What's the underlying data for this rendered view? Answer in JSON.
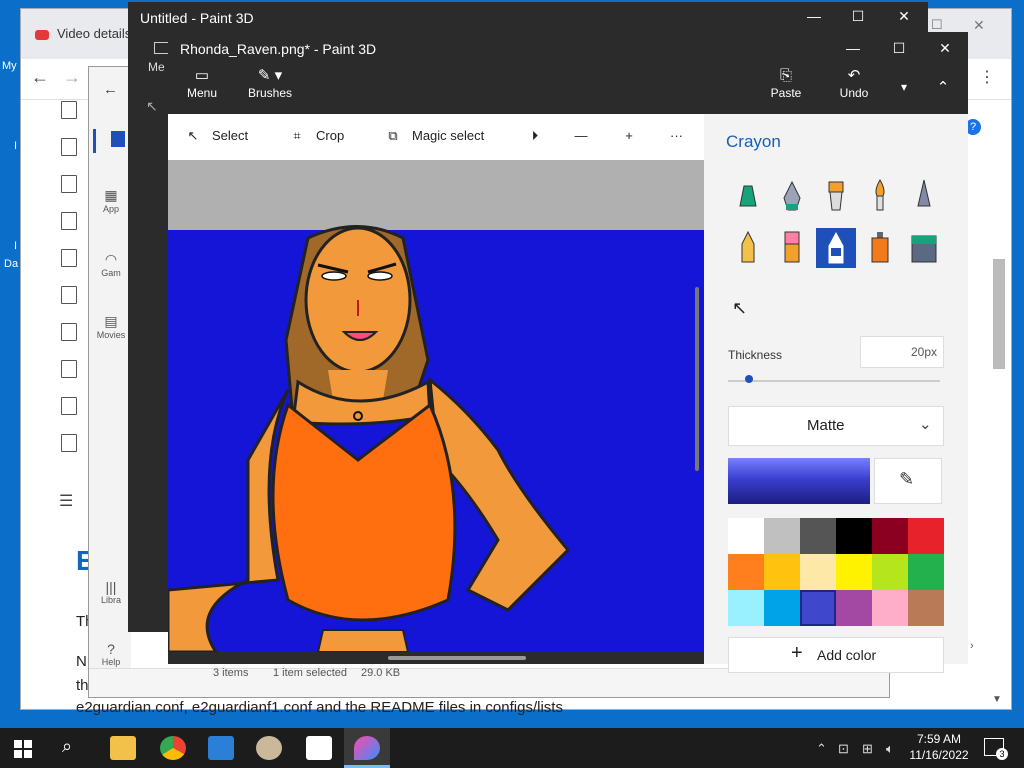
{
  "desktop": {
    "labels": [
      "My",
      "I",
      "I",
      "Da"
    ]
  },
  "browser": {
    "tab_title": "Video details",
    "lines": {
      "heading": "E",
      "line1": "Th",
      "line2": "N",
      "line3": "th",
      "line4": "e2guardian.conf, e2guardianf1.conf and the README files in configs/lists"
    }
  },
  "explorer": {
    "side": [
      {
        "label": "App"
      },
      {
        "label": "Gam"
      },
      {
        "label": "Movies"
      },
      {
        "label": "Libra"
      },
      {
        "label": "Help"
      }
    ],
    "status": {
      "items": "3 items",
      "selected": "1 item selected",
      "size": "29.0 KB"
    }
  },
  "untitled_window": {
    "title": "Untitled - Paint 3D",
    "menu_partial": "Me"
  },
  "paint": {
    "title": "Rhonda_Raven.png* - Paint 3D",
    "ribbon": {
      "menu_label": "Menu",
      "brushes_label": "Brushes",
      "paste_label": "Paste",
      "undo_label": "Undo"
    },
    "toolbar": {
      "select_label": "Select",
      "crop_label": "Crop",
      "magic_select_label": "Magic select",
      "more_label": "···"
    },
    "panel": {
      "title": "Crayon",
      "thickness_label": "Thickness",
      "thickness_value": "20px",
      "thickness_level": 0.1,
      "finish_value": "Matte",
      "current_color": "#3b3fd0",
      "add_color_label": "Add color",
      "palette": [
        "#ffffff",
        "#c0c0c0",
        "#555555",
        "#000000",
        "#8b0020",
        "#e8222a",
        "#ff7f1f",
        "#ffc20e",
        "#fde8a8",
        "#fff200",
        "#b5e61d",
        "#22b14c",
        "#99f0ff",
        "#00a2e8",
        "#3f48cc",
        "#a349a4",
        "#ffaec9",
        "#b97a57"
      ],
      "selected_swatch_index": 14
    }
  },
  "taskbar": {
    "time": "7:59 AM",
    "date": "11/16/2022",
    "notifications": "3"
  }
}
